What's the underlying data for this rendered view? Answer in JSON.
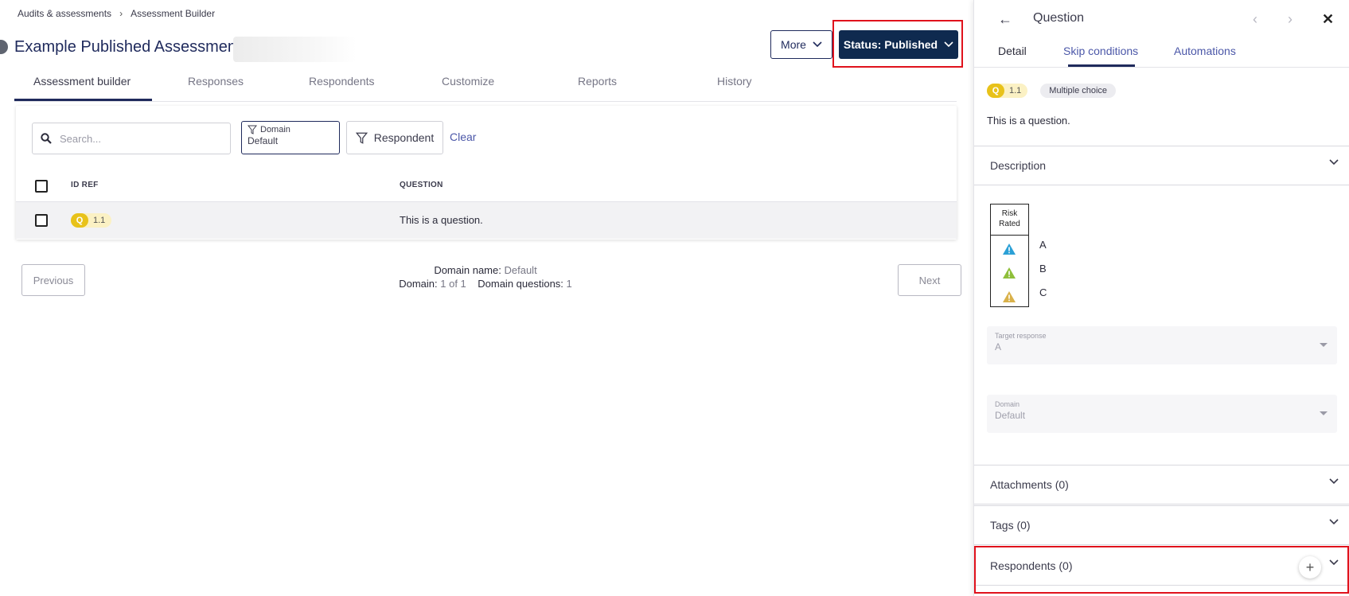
{
  "breadcrumb": {
    "items": [
      "Audits & assessments",
      "Assessment Builder"
    ]
  },
  "page": {
    "title": "Example Published Assessment"
  },
  "header": {
    "more_label": "More",
    "status_label": "Status: Published"
  },
  "tabs": [
    "Assessment builder",
    "Responses",
    "Respondents",
    "Customize",
    "Reports",
    "History"
  ],
  "filters": {
    "search_placeholder": "Search...",
    "domain_label": "Domain",
    "domain_value": "Default",
    "respondent_label": "Respondent",
    "clear_label": "Clear"
  },
  "table": {
    "headers": [
      "ID REF",
      "QUESTION"
    ],
    "rows": [
      {
        "badge": "Q",
        "id": "1.1",
        "question": "This is a question."
      }
    ]
  },
  "pager": {
    "previous": "Previous",
    "next": "Next",
    "domain_name_label": "Domain name:",
    "domain_name_value": "Default",
    "domain_label": "Domain:",
    "domain_value": "1 of 1",
    "domain_questions_label": "Domain questions:",
    "domain_questions_value": "1"
  },
  "panel": {
    "title": "Question",
    "tabs": [
      "Detail",
      "Skip conditions",
      "Automations"
    ],
    "badge": "Q",
    "id": "1.1",
    "type": "Multiple choice",
    "question": "This is a question.",
    "description_label": "Description",
    "risk_header": "Risk Rated",
    "risk_rows": [
      {
        "letter": "A",
        "color": "#2ba0d6"
      },
      {
        "letter": "B",
        "color": "#8fbf3a"
      },
      {
        "letter": "C",
        "color": "#d9b14a"
      }
    ],
    "target_response_label": "Target response",
    "target_response_value": "A",
    "domain_label": "Domain",
    "domain_value": "Default",
    "attachments_label": "Attachments (0)",
    "tags_label": "Tags (0)",
    "respondents_label": "Respondents (0)"
  },
  "colors": {
    "primary": "#0f2a4f",
    "accent": "#4b57a8",
    "badge_yellow": "#e8c21a",
    "highlight": "#e0121c"
  }
}
